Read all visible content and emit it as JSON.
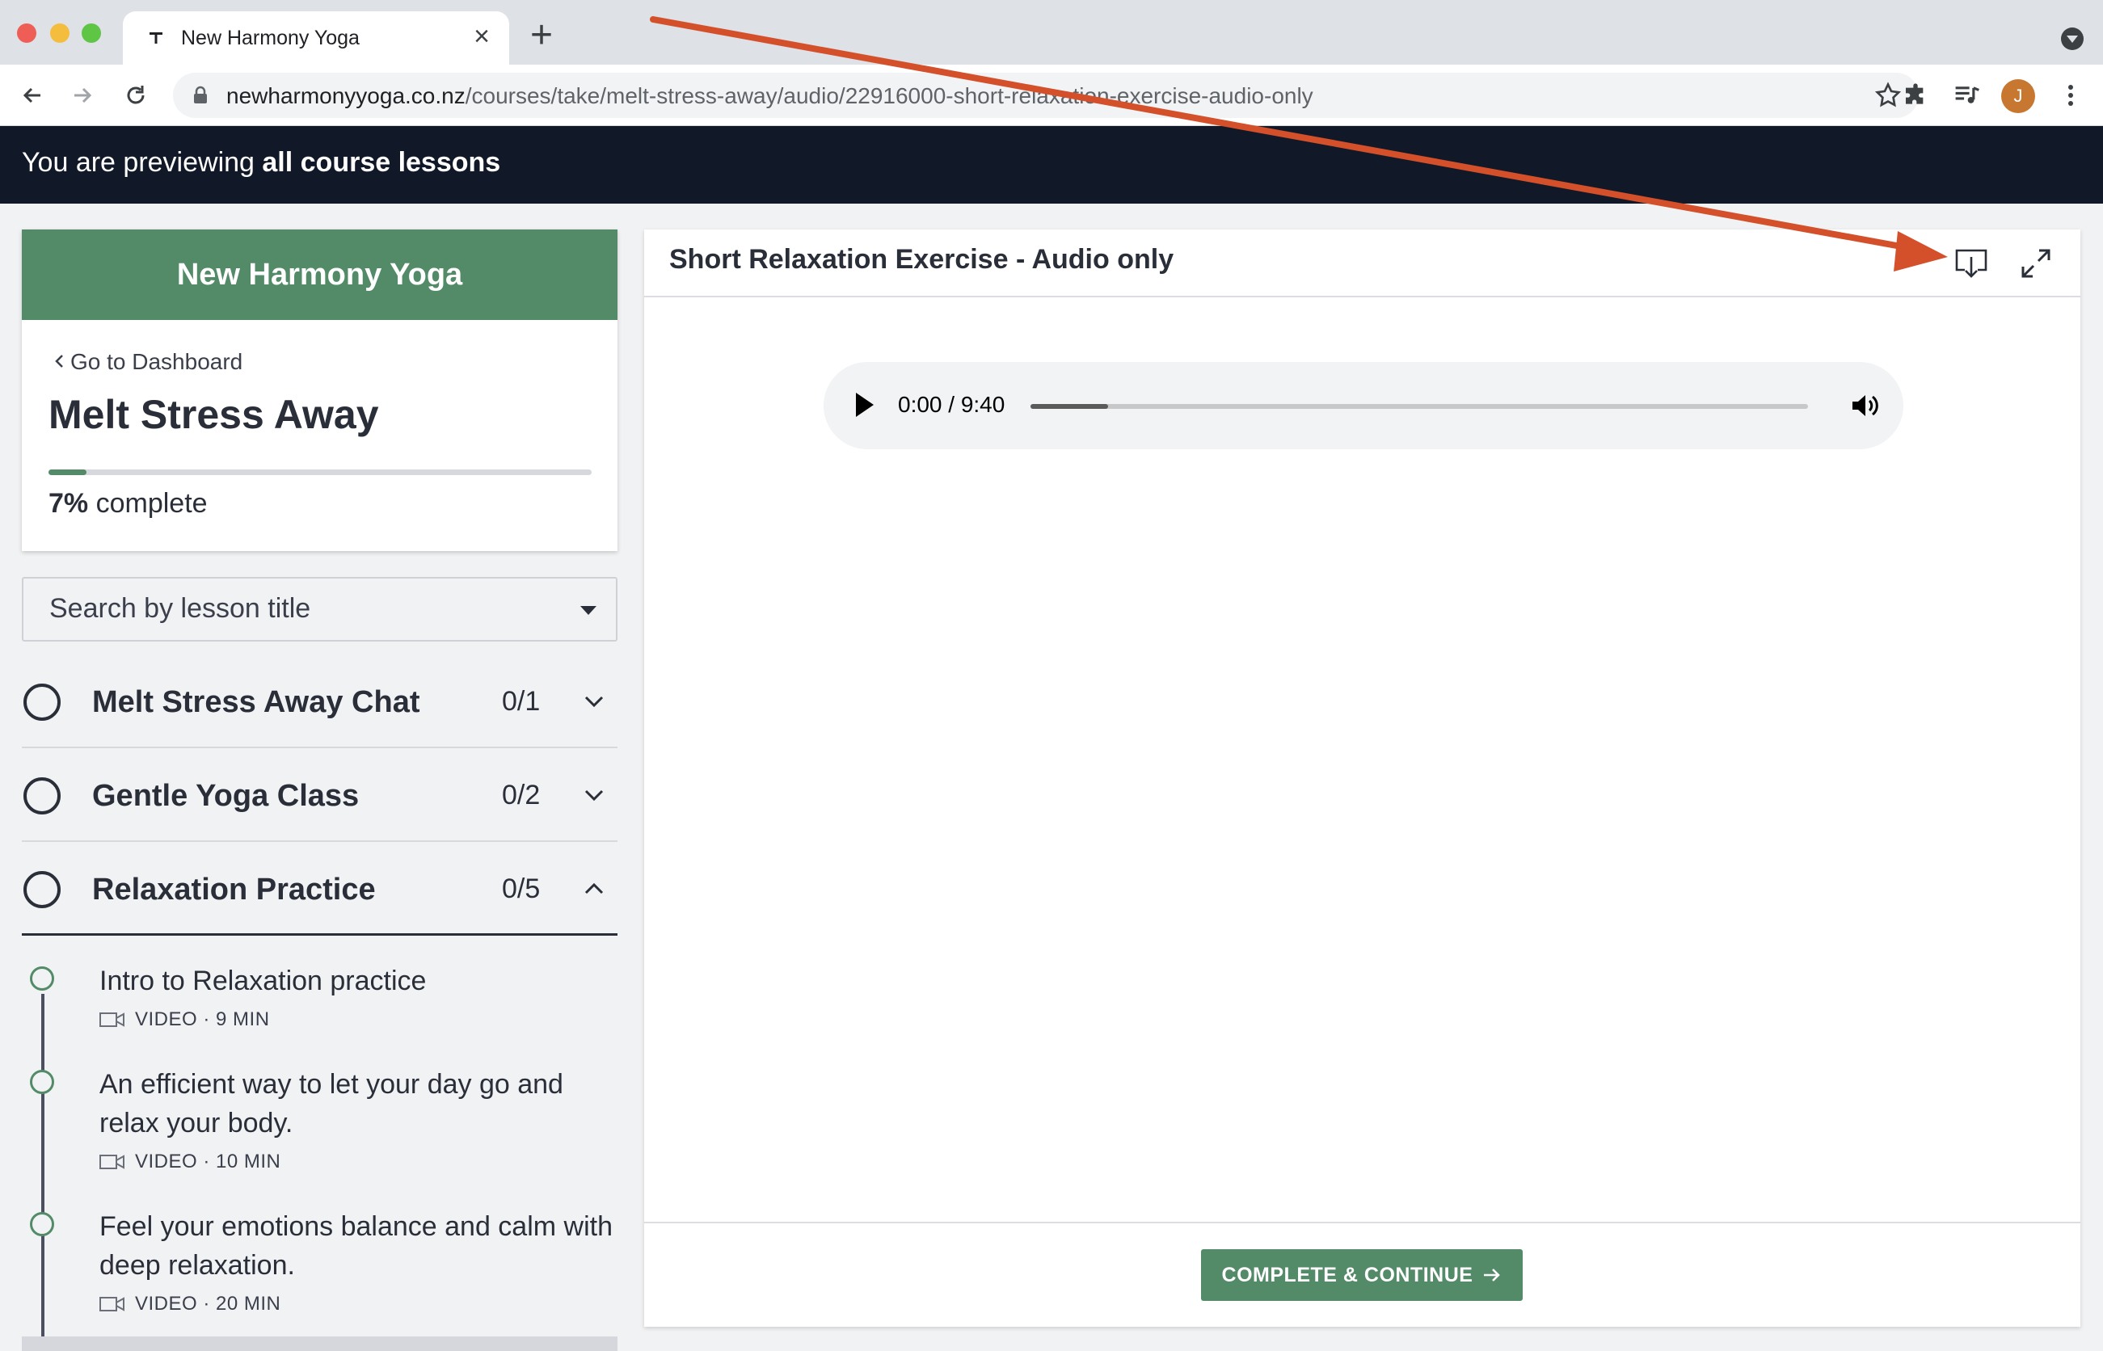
{
  "browser": {
    "tab_title": "New Harmony Yoga",
    "url_host": "newharmonyyoga.co.nz",
    "url_path": "/courses/take/melt-stress-away/audio/22916000-short-relaxation-exercise-audio-only",
    "profile_initial": "J"
  },
  "banner": {
    "prefix": "You are previewing ",
    "emphasis": "all course lessons"
  },
  "course": {
    "school_name": "New Harmony Yoga",
    "back_label": "Go to Dashboard",
    "title": "Melt Stress Away",
    "progress_percent": 7,
    "progress_label": "7%",
    "complete_label": " complete"
  },
  "search": {
    "placeholder": "Search by lesson title"
  },
  "chapters": [
    {
      "title": "Melt Stress Away Chat",
      "count": "0/1",
      "expanded": false
    },
    {
      "title": "Gentle Yoga Class",
      "count": "0/2",
      "expanded": false
    },
    {
      "title": "Relaxation Practice",
      "count": "0/5",
      "expanded": true
    }
  ],
  "lessons": [
    {
      "title": "Intro to Relaxation practice",
      "meta": "VIDEO · 9 MIN"
    },
    {
      "title": "An efficient way to let your day go and relax your body.",
      "meta": "VIDEO · 10 MIN"
    },
    {
      "title": "Feel your emotions balance and calm with deep relaxation.",
      "meta": "VIDEO · 20 MIN"
    }
  ],
  "player": {
    "lesson_title": "Short Relaxation Exercise - Audio only",
    "time": "0:00 / 9:40",
    "buffered_fraction": 0.1
  },
  "footer": {
    "cta_label": "COMPLETE & CONTINUE"
  },
  "colors": {
    "brand_green": "#538b68",
    "banner_bg": "#111827",
    "annotation_arrow": "#d4502a"
  }
}
